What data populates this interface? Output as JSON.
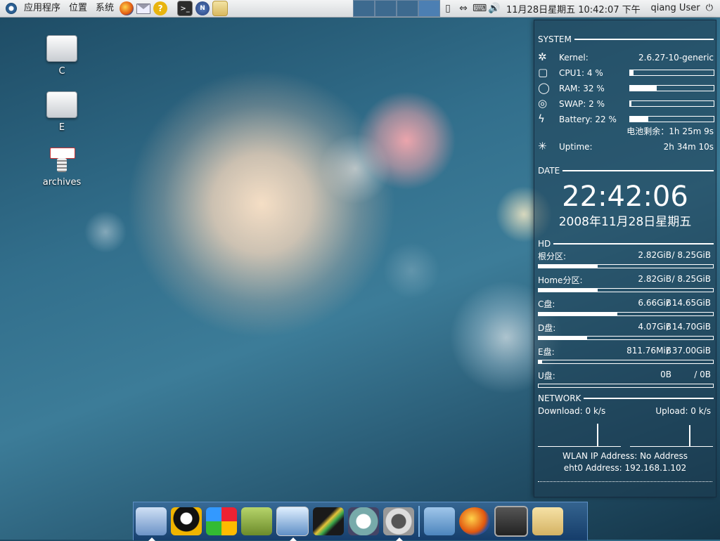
{
  "top_panel": {
    "menus": [
      "应用程序",
      "位置",
      "系统"
    ],
    "clock": "11月28日星期五 10:42:07 下午",
    "user": "qiang User",
    "launchers": [
      "firefox-icon",
      "mail-icon",
      "help-icon",
      "terminal-icon",
      "network-icon",
      "folder-icon"
    ],
    "tray_icons": [
      "battery-icon",
      "network-arrows-icon",
      "keyboard-icon",
      "volume-icon"
    ]
  },
  "desktop_icons": [
    {
      "label": "C",
      "icon": "drive-icon"
    },
    {
      "label": "E",
      "icon": "drive-icon"
    },
    {
      "label": "archives",
      "icon": "archive-icon"
    }
  ],
  "conky": {
    "system": {
      "header": "SYSTEM",
      "kernel_label": "Kernel:",
      "kernel_value": "2.6.27-10-generic",
      "cpu_label": "CPU1: 4  %",
      "cpu_percent": 4,
      "ram_label": "RAM: 32 %",
      "ram_percent": 32,
      "swap_label": "SWAP: 2  %",
      "swap_percent": 2,
      "battery_label": "Battery: 22 %",
      "battery_percent": 22,
      "battery_remaining": "电池剩余：1h 25m 9s",
      "uptime_label": "Uptime:",
      "uptime_value": "2h 34m 10s"
    },
    "date": {
      "header": "DATE",
      "time": "22:42:06",
      "date": "2008年11月28日星期五"
    },
    "hd": {
      "header": "HD",
      "partitions": [
        {
          "name": "根分区:",
          "used": "2.82GiB",
          "total": "/ 8.25GiB",
          "fraction": 0.34
        },
        {
          "name": "Home分区:",
          "used": "2.82GiB",
          "total": "/ 8.25GiB",
          "fraction": 0.34
        },
        {
          "name": "C盘:",
          "used": "6.66GiB",
          "total": "/ 14.65GiB",
          "fraction": 0.45
        },
        {
          "name": "D盘:",
          "used": "4.07GiB",
          "total": "/ 14.70GiB",
          "fraction": 0.28
        },
        {
          "name": "E盘:",
          "used": "811.76MiB",
          "total": "/ 37.00GiB",
          "fraction": 0.02
        },
        {
          "name": "U盘:",
          "used": "0B",
          "total": "/ 0B",
          "fraction": 0
        }
      ]
    },
    "network": {
      "header": "NETWORK",
      "download": "Download: 0    k/s",
      "upload": "Upload:  0    k/s",
      "wlan": "WLAN IP Address: No Address",
      "eth": "eht0 Address: 192.168.1.102"
    }
  },
  "dock": {
    "items": [
      "save-icon",
      "qq-icon",
      "color-icon",
      "books-icon",
      "monitor-icon",
      "graph-icon",
      "media-icon",
      "headphones-icon",
      "folder-icon",
      "firefox-icon",
      "terminal-icon",
      "trash-icon"
    ]
  }
}
